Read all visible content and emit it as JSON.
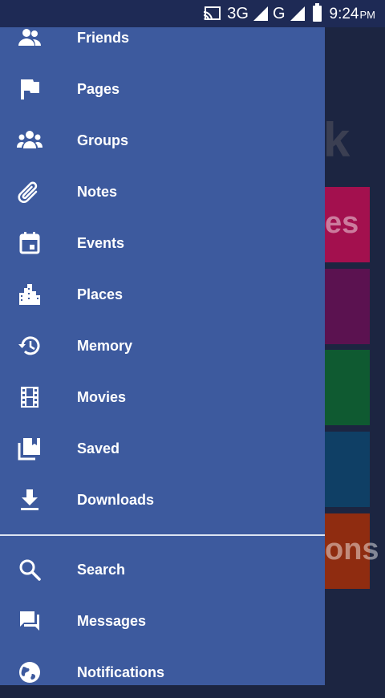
{
  "status_bar": {
    "network": "3G",
    "network2": "G",
    "time": "9:24",
    "ampm": "PM"
  },
  "background": {
    "tiles": [
      {
        "color": "#a3104e",
        "text": "es"
      },
      {
        "color": "#5b1250",
        "text": ""
      },
      {
        "color": "#0f5a31",
        "text": ""
      },
      {
        "color": "#0f3f65",
        "text": ""
      },
      {
        "color": "#8f2c10",
        "text": "ons"
      }
    ]
  },
  "drawer": {
    "items": [
      {
        "label": "Friends",
        "icon": "friends-icon"
      },
      {
        "label": "Pages",
        "icon": "flag-icon"
      },
      {
        "label": "Groups",
        "icon": "groups-icon"
      },
      {
        "label": "Notes",
        "icon": "paperclip-icon"
      },
      {
        "label": "Events",
        "icon": "calendar-icon"
      },
      {
        "label": "Places",
        "icon": "city-icon"
      },
      {
        "label": "Memory",
        "icon": "history-icon"
      },
      {
        "label": "Movies",
        "icon": "film-icon"
      },
      {
        "label": "Saved",
        "icon": "saved-icon"
      },
      {
        "label": "Downloads",
        "icon": "download-icon"
      }
    ],
    "bottom_items": [
      {
        "label": "Search",
        "icon": "search-icon"
      },
      {
        "label": "Messages",
        "icon": "messages-icon"
      },
      {
        "label": "Notifications",
        "icon": "globe-icon"
      }
    ]
  },
  "colors": {
    "drawer": "#3d5a9e",
    "status_bar": "#1e2a55"
  }
}
